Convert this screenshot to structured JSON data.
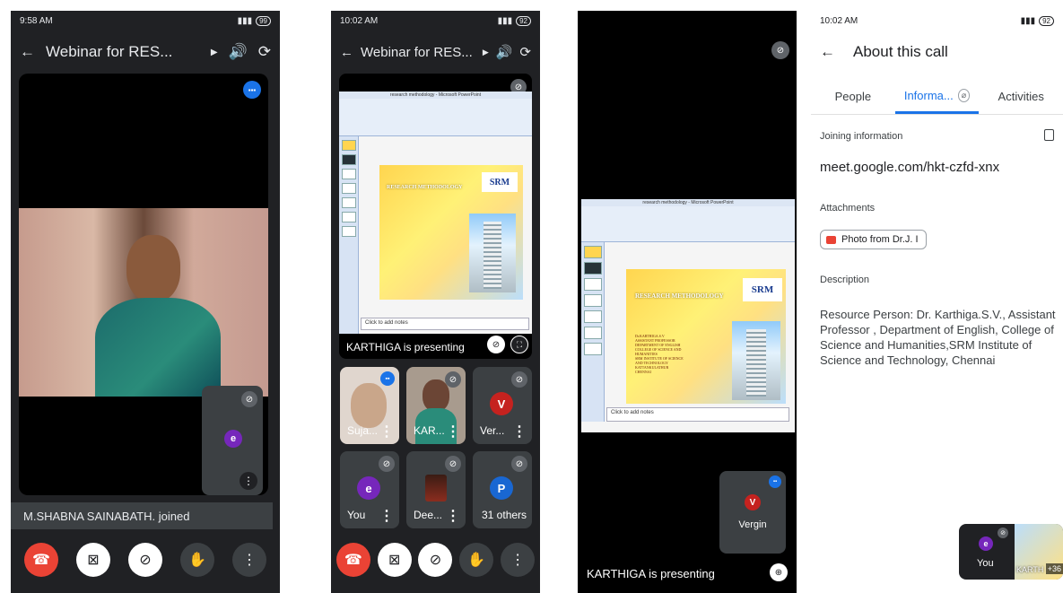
{
  "phone1": {
    "status": {
      "time": "9:58 AM",
      "battery": "99"
    },
    "title": "Webinar for RES...",
    "toast": "M.SHABNA SAINABATH. joined",
    "self_avatar": "e"
  },
  "phone2": {
    "status": {
      "time": "10:02 AM",
      "battery": "92"
    },
    "title": "Webinar for RES...",
    "presenting": "KARTHIGA is presenting",
    "ppt_title": "research methodology - Microsoft PowerPoint",
    "slide_heading": "RESEARCH METHODOLOGY",
    "logo": "SRM",
    "notes_placeholder": "Click to add notes",
    "tiles": [
      {
        "name": "Suja...",
        "avatar": ""
      },
      {
        "name": "KAR...",
        "avatar": ""
      },
      {
        "name": "Ver...",
        "avatar": "V",
        "color": "#c5221f"
      },
      {
        "name": "You",
        "avatar": "e",
        "color": "#7627bb"
      },
      {
        "name": "Dee...",
        "avatar": ""
      },
      {
        "name": "31 others",
        "avatar": "P",
        "color": "#1967d2"
      }
    ]
  },
  "phone3": {
    "presenting": "KARTHIGA is presenting",
    "ppt_title": "research methodology - Microsoft PowerPoint",
    "slide_heading": "RESEARCH METHODOLOGY",
    "logo": "SRM",
    "notes_placeholder": "Click to add notes",
    "speaker_lines": [
      "Dr.KARTHIGA.S.V",
      "ASSISTANT PROFESSOR",
      "DEPARTMENT OF ENGLISH",
      "COLLEGE OF SCIENCE AND",
      "HUMANITIES",
      "SRM INSTITUTE OF SCIENCE",
      "AND TECHNOLOGY",
      "KATTANKULATHUR",
      "CHENNAI"
    ],
    "vergin": {
      "name": "Vergin",
      "avatar": "V"
    }
  },
  "phone4": {
    "status": {
      "time": "10:02 AM",
      "battery": "92"
    },
    "title": "About this call",
    "tabs": [
      "People",
      "Informa...",
      "Activities"
    ],
    "joining_label": "Joining information",
    "meet_link": "meet.google.com/hkt-czfd-xnx",
    "attachments_label": "Attachments",
    "attachment": "Photo from Dr.J. I",
    "description_label": "Description",
    "description": "Resource Person: Dr. Karthiga.S.V., Assistant Professor , Department of English, College  of Science and Humanities,SRM Institute of Science and Technology, Chennai",
    "pip_you": "You",
    "pip_avatar": "e",
    "pip_name": "KARTH",
    "pip_count": "+36"
  }
}
